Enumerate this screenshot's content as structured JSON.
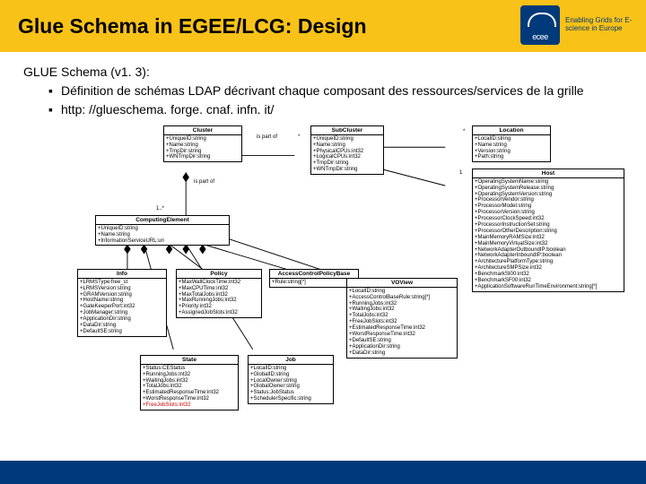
{
  "header": {
    "title": "Glue Schema in EGEE/LCG: Design"
  },
  "logo": {
    "tagline": "Enabling Grids for E-science in Europe"
  },
  "intro": "GLUE Schema (v1. 3):",
  "bullets": [
    "Définition de schémas LDAP décrivant chaque composant des ressources/services de la grille",
    "http: //glueschema. forge. cnaf. infn. it/"
  ],
  "uml": {
    "cluster": {
      "name": "Cluster",
      "attrs": [
        "+UniqueID:string",
        "+Name:string",
        "+TmpDir:string",
        "+WNTmpDir:string"
      ]
    },
    "subcluster": {
      "name": "SubCluster",
      "attrs": [
        "+UniqueID:string",
        "+Name:string",
        "+PhysicalCPUs:int32",
        "+LogicalCPUs:int32",
        "+TmpDir:string",
        "+WNTmpDir:string"
      ]
    },
    "location": {
      "name": "Location",
      "attrs": [
        "+LocalID:string",
        "+Name:string",
        "+Version:string",
        "+Path:string"
      ]
    },
    "ce": {
      "name": "ComputingElement",
      "attrs": [
        "+UniqueID:string",
        "+Name:string",
        "+InformationServiceURL:uri"
      ]
    },
    "host": {
      "name": "Host",
      "attrs": [
        "+OperatingSystemName:string",
        "+OperatingSystemRelease:string",
        "+OperatingSystemVersion:string",
        "+ProcessorVendor:string",
        "+ProcessorModel:string",
        "+ProcessorVersion:string",
        "+ProcessorClockSpeed:int32",
        "+ProcessorInstructionSet:string",
        "+ProcessorOtherDescription:string",
        "+MainMemoryRAMSize:int32",
        "+MainMemoryVirtualSize:int32",
        "+NetworkAdapterOutboundIP:boolean",
        "+NetworkAdapterInboundIP:boolean",
        "+ArchitecturePlatformType:string",
        "+ArchitectureSMPSize:int32",
        "+BenchmarkSI00:int32",
        "+BenchmarkSF00:int32",
        "+ApplicationSoftwareRunTimeEnvironment:string[*]"
      ]
    },
    "info": {
      "name": "Info",
      "attrs": [
        "+LRMSType:free_st",
        "+LRMSVersion:string",
        "+GRAMVersion:string",
        "+HostName:string",
        "+GateKeeperPort:int32",
        "+JobManager:string",
        "+ApplicationDir:string",
        "+DataDir:string",
        "+DefaultSE:string"
      ]
    },
    "policy": {
      "name": "Policy",
      "attrs": [
        "+MaxWallClockTime:int32",
        "+MaxCPUTime:int32",
        "+MaxTotalJobs:int32",
        "+MaxRunningJobs:int32",
        "+Priority:int32",
        "+AssignedJobSlots:int32"
      ]
    },
    "acb": {
      "name": "AccessControlPolicyBase",
      "attrs": [
        "+Rule:string[*]"
      ]
    },
    "voview": {
      "name": "VOView",
      "attrs": [
        "+LocalID:string",
        "+AccessControlBaseRule:string[*]",
        "+RunningJobs:int32",
        "+WaitingJobs:int32",
        "+TotalJobs:int32",
        "+FreeJobSlots:int32",
        "+EstimatedResponseTime:int32",
        "+WorstResponseTime:int32",
        "+DefaultSE:string",
        "+ApplicationDir:string",
        "+DataDir:string"
      ]
    },
    "state": {
      "name": "State",
      "attrs": [
        "+Status:CEStatus",
        "+RunningJobs:int32",
        "+WaitingJobs:int32",
        "+TotalJobs:int32",
        "+EstimatedResponseTime:int32",
        "+WorstResponseTime:int32",
        "+FreeJobSlots:int32"
      ]
    },
    "job": {
      "name": "Job",
      "attrs": [
        "+LocalID:string",
        "+GlobalID:string",
        "+LocalOwner:string",
        "+GlobalOwner:string",
        "+Status:JobStatus",
        "+SchedulerSpecific:string"
      ]
    }
  },
  "assoc": {
    "part_of_left": "is part of",
    "part_of_right": "is part of",
    "n1": "1..*",
    "star": "*",
    "one": "1"
  }
}
